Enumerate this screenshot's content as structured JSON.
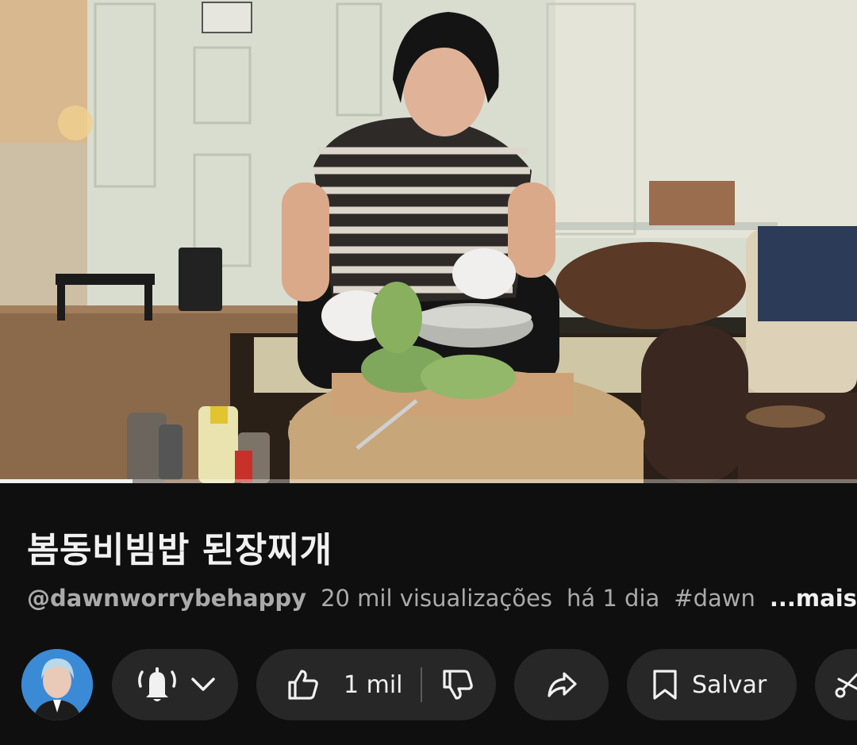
{
  "video": {
    "progress_fraction": 0.155
  },
  "info": {
    "title": "봄동비빔밥 된장찌개",
    "channel": "@dawnworrybehappy",
    "views": "20 mil visualizações",
    "age": "há 1 dia",
    "hashtag": "#dawn",
    "more_label": "...mais"
  },
  "actions": {
    "subscribe_icon": "bell-icon",
    "like_icon": "thumb-up-icon",
    "like_count": "1 mil",
    "dislike_icon": "thumb-down-icon",
    "share_icon": "share-arrow-icon",
    "save_icon": "bookmark-icon",
    "save_label": "Salvar",
    "clip_icon": "scissors-icon"
  },
  "colors": {
    "background": "#0f0f0f",
    "pill": "#272727",
    "text_primary": "#f1f1f1",
    "text_secondary": "#aaaaaa"
  }
}
